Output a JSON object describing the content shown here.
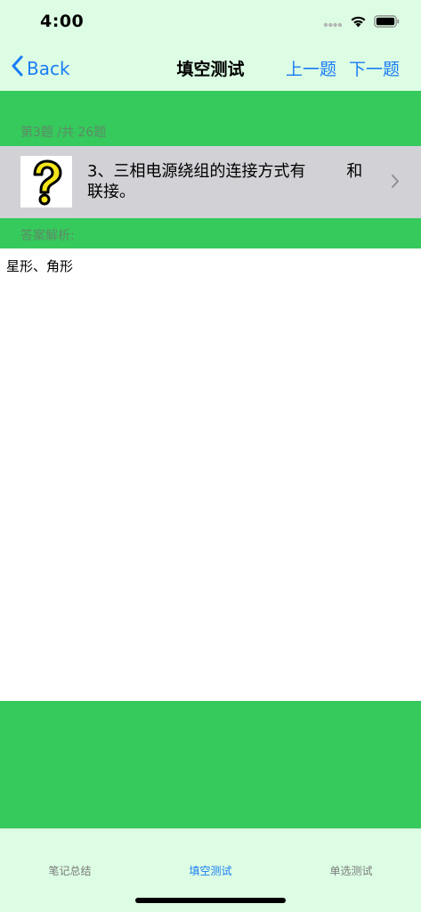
{
  "status_bar": {
    "time": "4:00",
    "icons": [
      "signal-dots-icon",
      "wifi-icon",
      "battery-icon"
    ]
  },
  "nav": {
    "back_label": "Back",
    "title": "填空测试",
    "prev_label": "上一题",
    "next_label": "下一题"
  },
  "quiz": {
    "counter": "第3题 /共 26题",
    "question": "3、三相电源绕组的连接方式有        和\n联接。",
    "thumbnail_icon": "question-mark-icon",
    "analysis_label": "答案解析:",
    "answer": "星形、角形"
  },
  "tabs": [
    {
      "label": "笔记总结",
      "active": false
    },
    {
      "label": "填空测试",
      "active": true
    },
    {
      "label": "单选测试",
      "active": false
    }
  ],
  "colors": {
    "accent": "#1a7cf5",
    "green": "#36c95c",
    "mint": "#dcfde3",
    "row_gray": "#d1d1d6"
  }
}
